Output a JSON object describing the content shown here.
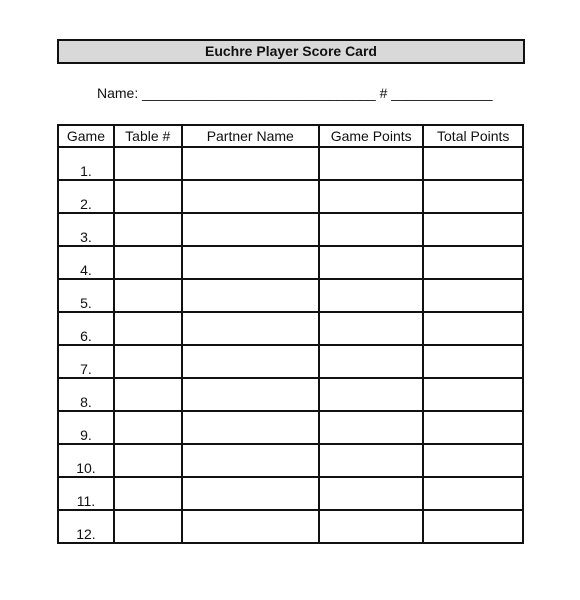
{
  "title": "Euchre Player Score Card",
  "name_field": {
    "label": "Name:",
    "blank": "______________________________",
    "number_label": "#",
    "number_blank": "_____________"
  },
  "table": {
    "headers": [
      "Game",
      "Table #",
      "Partner Name",
      "Game Points",
      "Total Points"
    ],
    "rows": [
      {
        "game": "1."
      },
      {
        "game": "2."
      },
      {
        "game": "3."
      },
      {
        "game": "4."
      },
      {
        "game": "5."
      },
      {
        "game": "6."
      },
      {
        "game": "7."
      },
      {
        "game": "8."
      },
      {
        "game": "9."
      },
      {
        "game": "10."
      },
      {
        "game": "11."
      },
      {
        "game": "12."
      }
    ]
  }
}
